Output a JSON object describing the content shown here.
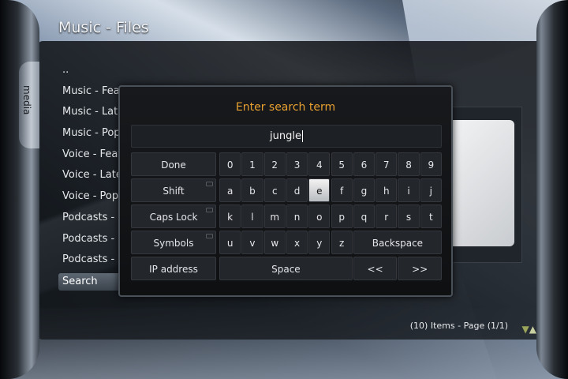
{
  "header": {
    "title": "Music - Files"
  },
  "side_tab": {
    "label": "media"
  },
  "file_list": {
    "items": [
      "..",
      "Music - Featured",
      "Music - Latest",
      "Music - Popular",
      "Voice - Featured",
      "Voice - Latest",
      "Voice - Popular",
      "Podcasts - Featured",
      "Podcasts - Latest",
      "Podcasts - Popular",
      "Search"
    ],
    "selected_index": 10
  },
  "footer": {
    "info": "(10) Items - Page (1/1)",
    "down_icon": "triangle-down-icon",
    "up_icon": "triangle-up-icon"
  },
  "keyboard": {
    "title": "Enter search term",
    "input_value": "jungle",
    "highlight_color": "#e8a030",
    "left_keys": [
      "Done",
      "Shift",
      "Caps Lock",
      "Symbols",
      "IP address"
    ],
    "row_numbers": [
      "0",
      "1",
      "2",
      "3",
      "4",
      "5",
      "6",
      "7",
      "8",
      "9"
    ],
    "row_a": [
      "a",
      "b",
      "c",
      "d",
      "e",
      "f",
      "g",
      "h",
      "i",
      "j"
    ],
    "row_k": [
      "k",
      "l",
      "m",
      "n",
      "o",
      "p",
      "q",
      "r",
      "s",
      "t"
    ],
    "row_u": [
      "u",
      "v",
      "w",
      "x",
      "y",
      "z"
    ],
    "backspace": "Backspace",
    "space": "Space",
    "prev": "<<",
    "next": ">>",
    "focused_key": "e"
  }
}
